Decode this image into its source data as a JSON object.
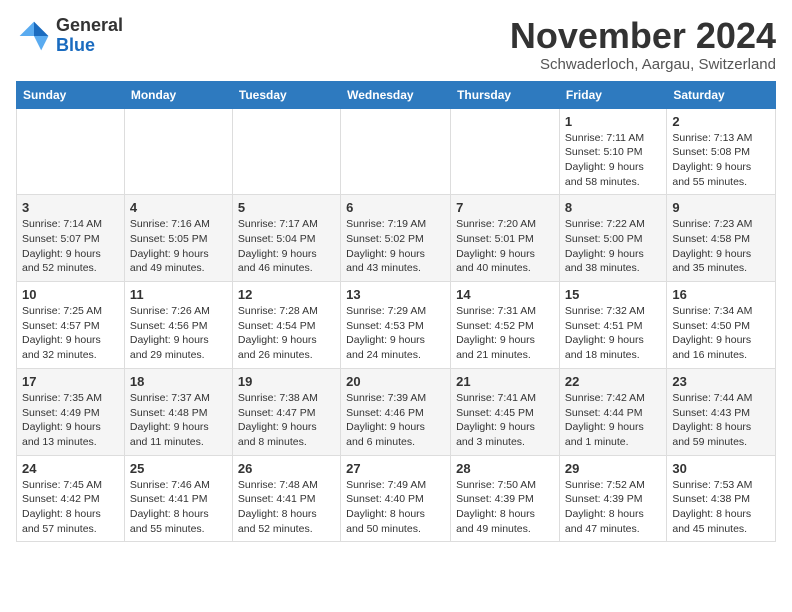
{
  "logo": {
    "general": "General",
    "blue": "Blue"
  },
  "header": {
    "title": "November 2024",
    "subtitle": "Schwaderloch, Aargau, Switzerland"
  },
  "weekdays": [
    "Sunday",
    "Monday",
    "Tuesday",
    "Wednesday",
    "Thursday",
    "Friday",
    "Saturday"
  ],
  "weeks": [
    [
      {
        "day": "",
        "info": ""
      },
      {
        "day": "",
        "info": ""
      },
      {
        "day": "",
        "info": ""
      },
      {
        "day": "",
        "info": ""
      },
      {
        "day": "",
        "info": ""
      },
      {
        "day": "1",
        "info": "Sunrise: 7:11 AM\nSunset: 5:10 PM\nDaylight: 9 hours and 58 minutes."
      },
      {
        "day": "2",
        "info": "Sunrise: 7:13 AM\nSunset: 5:08 PM\nDaylight: 9 hours and 55 minutes."
      }
    ],
    [
      {
        "day": "3",
        "info": "Sunrise: 7:14 AM\nSunset: 5:07 PM\nDaylight: 9 hours and 52 minutes."
      },
      {
        "day": "4",
        "info": "Sunrise: 7:16 AM\nSunset: 5:05 PM\nDaylight: 9 hours and 49 minutes."
      },
      {
        "day": "5",
        "info": "Sunrise: 7:17 AM\nSunset: 5:04 PM\nDaylight: 9 hours and 46 minutes."
      },
      {
        "day": "6",
        "info": "Sunrise: 7:19 AM\nSunset: 5:02 PM\nDaylight: 9 hours and 43 minutes."
      },
      {
        "day": "7",
        "info": "Sunrise: 7:20 AM\nSunset: 5:01 PM\nDaylight: 9 hours and 40 minutes."
      },
      {
        "day": "8",
        "info": "Sunrise: 7:22 AM\nSunset: 5:00 PM\nDaylight: 9 hours and 38 minutes."
      },
      {
        "day": "9",
        "info": "Sunrise: 7:23 AM\nSunset: 4:58 PM\nDaylight: 9 hours and 35 minutes."
      }
    ],
    [
      {
        "day": "10",
        "info": "Sunrise: 7:25 AM\nSunset: 4:57 PM\nDaylight: 9 hours and 32 minutes."
      },
      {
        "day": "11",
        "info": "Sunrise: 7:26 AM\nSunset: 4:56 PM\nDaylight: 9 hours and 29 minutes."
      },
      {
        "day": "12",
        "info": "Sunrise: 7:28 AM\nSunset: 4:54 PM\nDaylight: 9 hours and 26 minutes."
      },
      {
        "day": "13",
        "info": "Sunrise: 7:29 AM\nSunset: 4:53 PM\nDaylight: 9 hours and 24 minutes."
      },
      {
        "day": "14",
        "info": "Sunrise: 7:31 AM\nSunset: 4:52 PM\nDaylight: 9 hours and 21 minutes."
      },
      {
        "day": "15",
        "info": "Sunrise: 7:32 AM\nSunset: 4:51 PM\nDaylight: 9 hours and 18 minutes."
      },
      {
        "day": "16",
        "info": "Sunrise: 7:34 AM\nSunset: 4:50 PM\nDaylight: 9 hours and 16 minutes."
      }
    ],
    [
      {
        "day": "17",
        "info": "Sunrise: 7:35 AM\nSunset: 4:49 PM\nDaylight: 9 hours and 13 minutes."
      },
      {
        "day": "18",
        "info": "Sunrise: 7:37 AM\nSunset: 4:48 PM\nDaylight: 9 hours and 11 minutes."
      },
      {
        "day": "19",
        "info": "Sunrise: 7:38 AM\nSunset: 4:47 PM\nDaylight: 9 hours and 8 minutes."
      },
      {
        "day": "20",
        "info": "Sunrise: 7:39 AM\nSunset: 4:46 PM\nDaylight: 9 hours and 6 minutes."
      },
      {
        "day": "21",
        "info": "Sunrise: 7:41 AM\nSunset: 4:45 PM\nDaylight: 9 hours and 3 minutes."
      },
      {
        "day": "22",
        "info": "Sunrise: 7:42 AM\nSunset: 4:44 PM\nDaylight: 9 hours and 1 minute."
      },
      {
        "day": "23",
        "info": "Sunrise: 7:44 AM\nSunset: 4:43 PM\nDaylight: 8 hours and 59 minutes."
      }
    ],
    [
      {
        "day": "24",
        "info": "Sunrise: 7:45 AM\nSunset: 4:42 PM\nDaylight: 8 hours and 57 minutes."
      },
      {
        "day": "25",
        "info": "Sunrise: 7:46 AM\nSunset: 4:41 PM\nDaylight: 8 hours and 55 minutes."
      },
      {
        "day": "26",
        "info": "Sunrise: 7:48 AM\nSunset: 4:41 PM\nDaylight: 8 hours and 52 minutes."
      },
      {
        "day": "27",
        "info": "Sunrise: 7:49 AM\nSunset: 4:40 PM\nDaylight: 8 hours and 50 minutes."
      },
      {
        "day": "28",
        "info": "Sunrise: 7:50 AM\nSunset: 4:39 PM\nDaylight: 8 hours and 49 minutes."
      },
      {
        "day": "29",
        "info": "Sunrise: 7:52 AM\nSunset: 4:39 PM\nDaylight: 8 hours and 47 minutes."
      },
      {
        "day": "30",
        "info": "Sunrise: 7:53 AM\nSunset: 4:38 PM\nDaylight: 8 hours and 45 minutes."
      }
    ]
  ]
}
